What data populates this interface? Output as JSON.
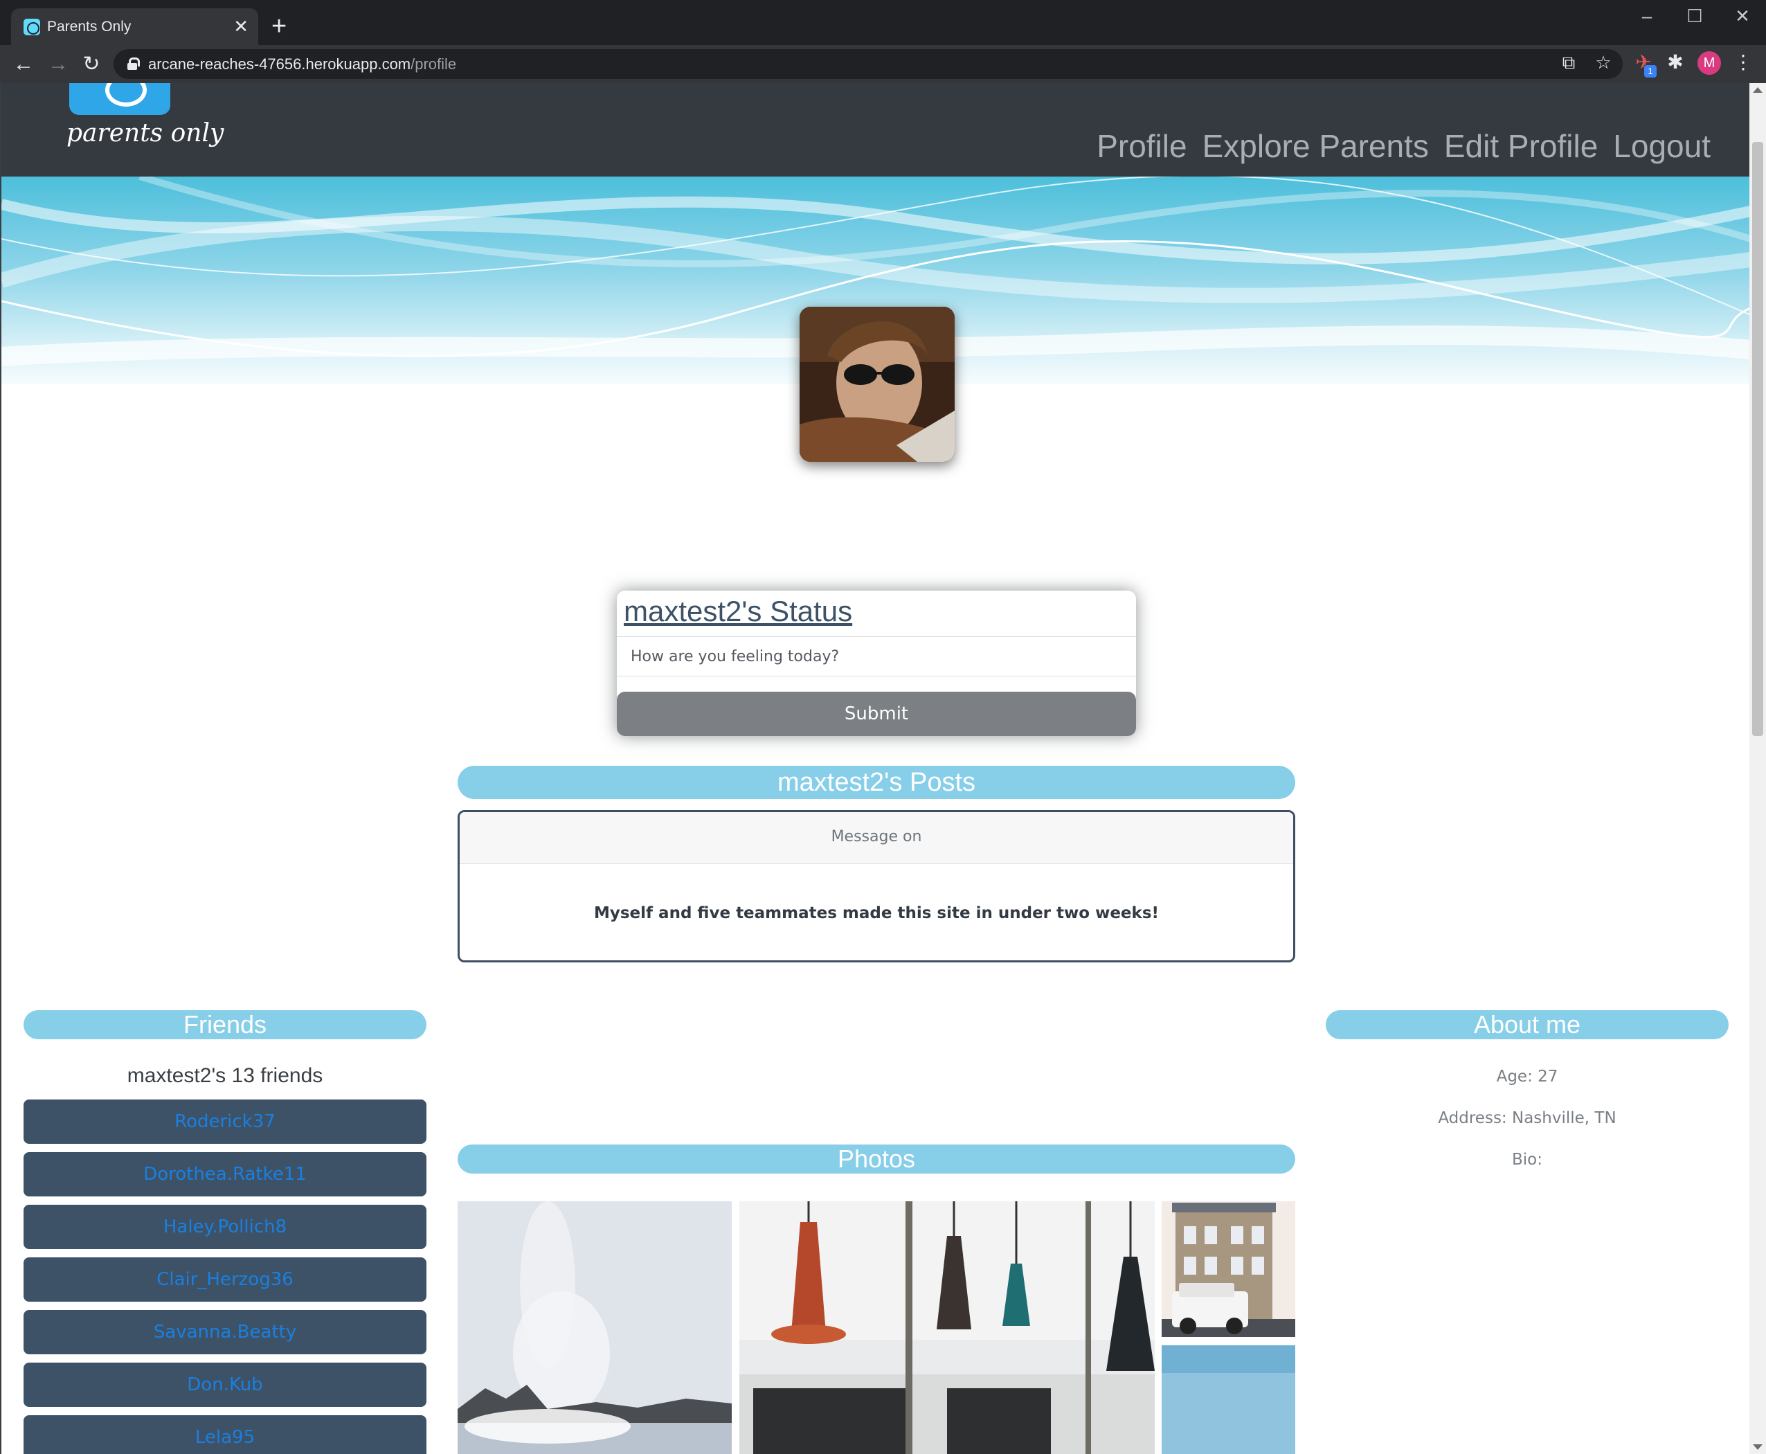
{
  "browser": {
    "tab_title": "Parents Only",
    "tab_close": "✕",
    "new_tab": "+",
    "url_host": "arcane-reaches-47656.herokuapp.com",
    "url_path": "/profile",
    "profile_initial": "M",
    "extension_badge": "1",
    "icons": [
      "react-favicon-icon",
      "back-arrow-icon",
      "forward-arrow-icon",
      "reload-icon",
      "lock-icon",
      "open-in-app-icon",
      "bookmark-star-icon",
      "extension-icon",
      "puzzle-icon",
      "profile-avatar",
      "more-menu-icon",
      "minimize-icon",
      "maximize-icon",
      "close-window-icon"
    ]
  },
  "site": {
    "logo_text": "parents only",
    "nav": [
      "Profile",
      "Explore Parents",
      "Edit Profile",
      "Logout"
    ]
  },
  "status": {
    "title": "maxtest2's Status",
    "placeholder": "How are you feeling today?",
    "submit_label": "Submit"
  },
  "posts": {
    "heading": "maxtest2's Posts",
    "items": [
      {
        "header": "Message on",
        "body": "Myself and five teammates made this site in under two weeks!"
      }
    ]
  },
  "friends": {
    "heading": "Friends",
    "count_label": "maxtest2's 13 friends",
    "list": [
      "Roderick37",
      "Dorothea.Ratke11",
      "Haley.Pollich8",
      "Clair_Herzog36",
      "Savanna.Beatty",
      "Don.Kub",
      "Lela95"
    ]
  },
  "photos": {
    "heading": "Photos"
  },
  "about": {
    "heading": "About me",
    "age": "Age: 27",
    "address": "Address: Nashville, TN",
    "bio": "Bio:"
  },
  "colors": {
    "header_bg": "#343a40",
    "pill": "#87cee8",
    "friend_button": "#3d5266",
    "friend_link": "#1a7fe0",
    "submit": "#7c7f83"
  }
}
